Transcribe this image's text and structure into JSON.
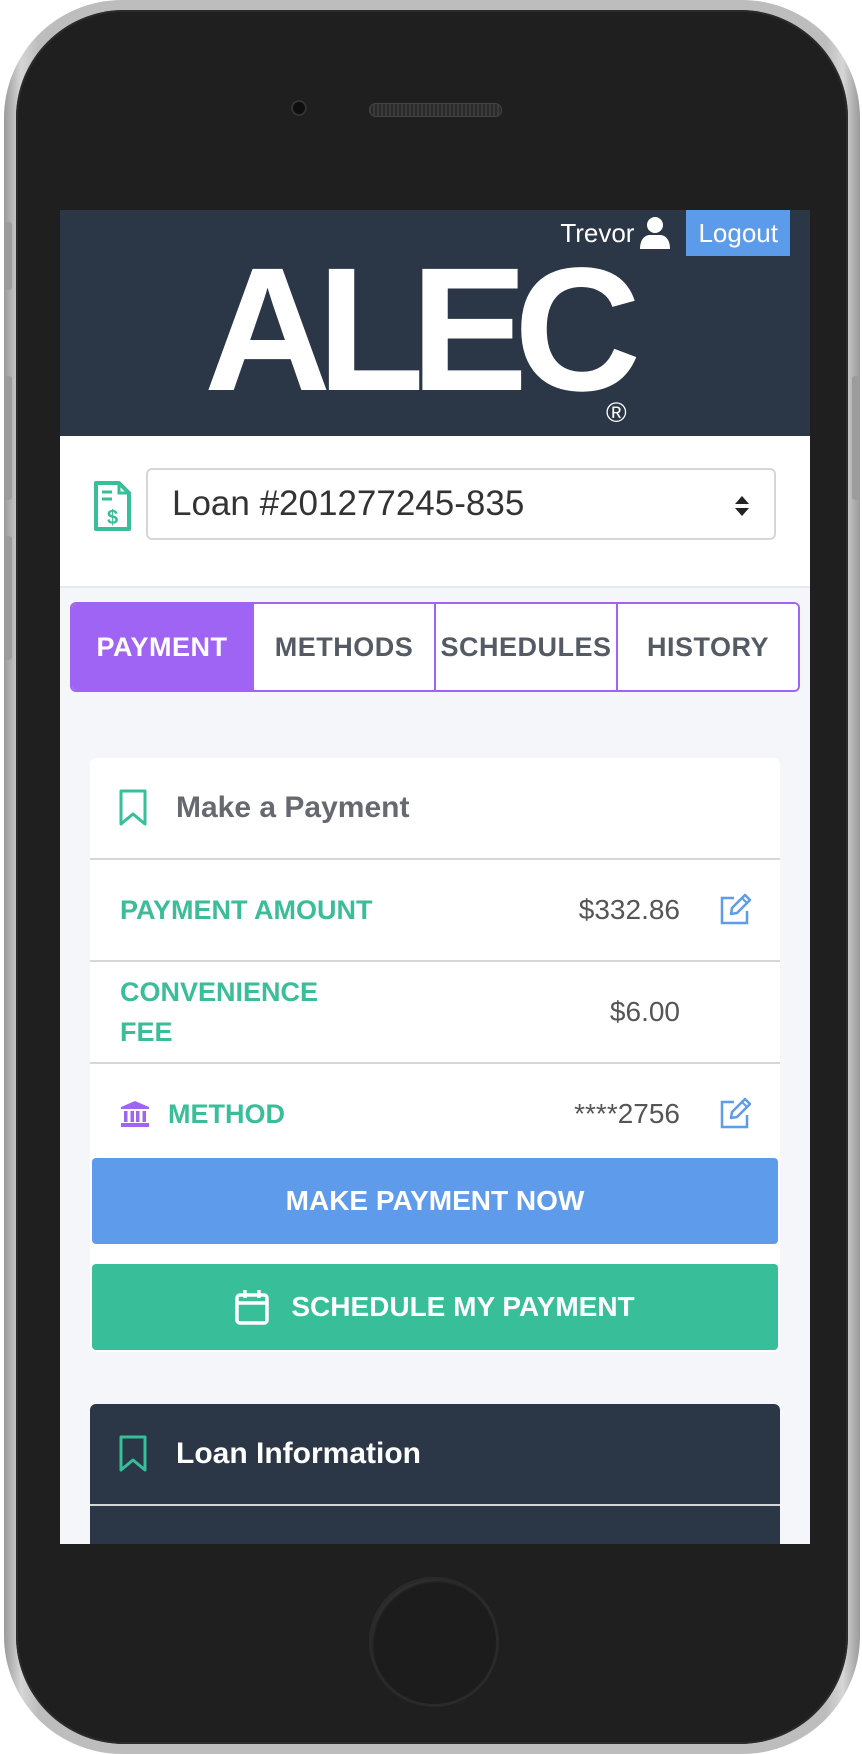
{
  "header": {
    "user_name": "Trevor",
    "logout_label": "Logout",
    "logo_text": "ALEC",
    "logo_mark": "®"
  },
  "loan_selector": {
    "icon": "invoice-dollar-icon",
    "selected": "Loan #201277245-835"
  },
  "tabs": [
    {
      "label": "PAYMENT",
      "active": true
    },
    {
      "label": "METHODS",
      "active": false
    },
    {
      "label": "SCHEDULES",
      "active": false
    },
    {
      "label": "HISTORY",
      "active": false
    }
  ],
  "payment_card": {
    "title": "Make a Payment",
    "rows": [
      {
        "label": "PAYMENT AMOUNT",
        "value": "$332.86",
        "editable": true
      },
      {
        "label": "CONVENIENCE FEE",
        "value": "$6.00",
        "editable": false
      },
      {
        "label": "METHOD",
        "value": "****2756",
        "editable": true,
        "icon": "bank-icon"
      }
    ],
    "make_payment_label": "MAKE PAYMENT NOW",
    "schedule_label": "SCHEDULE MY PAYMENT"
  },
  "loan_info_card": {
    "title": "Loan Information"
  },
  "colors": {
    "header_bg": "#2b3646",
    "accent_purple": "#a064f5",
    "accent_green": "#38be98",
    "accent_blue": "#5e9bea"
  }
}
